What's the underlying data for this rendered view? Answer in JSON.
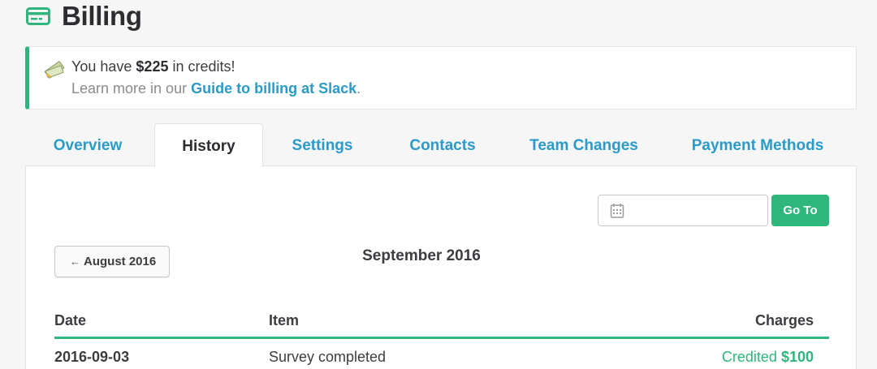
{
  "page": {
    "title": "Billing",
    "title_icon": "credit-card-icon"
  },
  "banner": {
    "icon": "money-bills-icon",
    "prefix": "You have ",
    "amount": "$225",
    "suffix": " in credits!",
    "learn_prefix": "Learn more in our ",
    "link_text": "Guide to billing at Slack",
    "learn_suffix": "."
  },
  "tabs": [
    {
      "label": "Overview",
      "active": false
    },
    {
      "label": "History",
      "active": true
    },
    {
      "label": "Settings",
      "active": false
    },
    {
      "label": "Contacts",
      "active": false
    },
    {
      "label": "Team Changes",
      "active": false
    },
    {
      "label": "Payment Methods",
      "active": false
    }
  ],
  "history": {
    "date_input": {
      "value": "",
      "icon": "calendar-icon"
    },
    "go_button_label": "Go To",
    "prev_month_arrow": "←",
    "prev_month_label": "August 2016",
    "current_month": "September 2016",
    "columns": {
      "date": "Date",
      "item": "Item",
      "charges": "Charges"
    },
    "rows": [
      {
        "date": "2016-09-03",
        "item": "Survey completed",
        "charge_status": "Credited",
        "charge_amount": "$100"
      }
    ]
  },
  "colors": {
    "accent_green": "#2eb67d",
    "link_blue": "#2a9bc9",
    "background": "#f6f6f6"
  }
}
